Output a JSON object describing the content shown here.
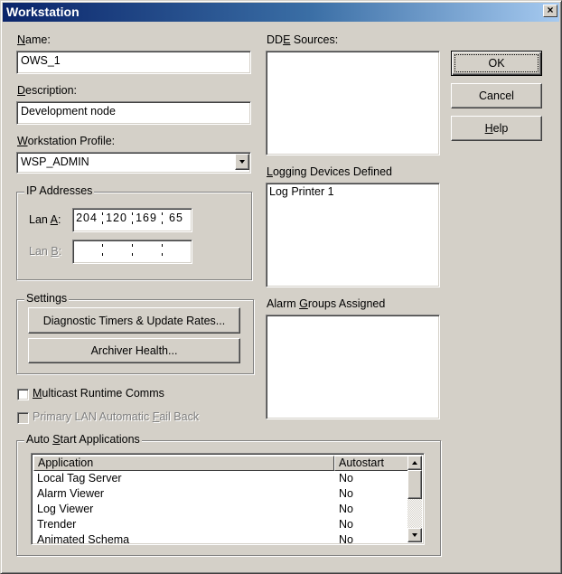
{
  "window": {
    "title": "Workstation",
    "close_glyph": "×"
  },
  "name": {
    "label_pre": "",
    "label_key": "N",
    "label_post": "ame:",
    "value": "OWS_1"
  },
  "description": {
    "label_pre": "",
    "label_key": "D",
    "label_post": "escription:",
    "value": "Development node"
  },
  "profile": {
    "label_pre": "",
    "label_key": "W",
    "label_post": "orkstation Profile:",
    "value": "WSP_ADMIN"
  },
  "ip": {
    "group_label": "IP Addresses",
    "lan_a_pre": "Lan ",
    "lan_a_key": "A",
    "lan_a_post": ":",
    "lan_b_pre": "Lan ",
    "lan_b_key": "B",
    "lan_b_post": ":",
    "lan_a": [
      "204",
      "120",
      "169",
      "65"
    ],
    "lan_b": [
      "",
      "",
      "",
      ""
    ]
  },
  "settings": {
    "group_label": "Settings",
    "diag_button": "Diagnostic Timers & Update Rates...",
    "archiver_button": "Archiver Health..."
  },
  "multicast": {
    "pre": "",
    "key": "M",
    "post": "ulticast Runtime Comms",
    "checked": false
  },
  "primary_lan": {
    "pre": "Primary LAN Automatic ",
    "key": "F",
    "post": "ail Back",
    "checked": false,
    "disabled": true
  },
  "dde": {
    "pre": "DD",
    "key": "E",
    "post": " Sources:",
    "items": []
  },
  "logging": {
    "pre": "",
    "key": "L",
    "post": "ogging Devices Defined",
    "items": [
      "Log Printer 1"
    ]
  },
  "alarm": {
    "pre": "Alarm ",
    "key": "G",
    "post": "roups Assigned",
    "items": []
  },
  "buttons": {
    "ok": "OK",
    "cancel": "Cancel",
    "help_key": "H",
    "help_post": "elp"
  },
  "autostart": {
    "group_pre": "Auto ",
    "group_key": "S",
    "group_post": "tart Applications",
    "columns": [
      "Application",
      "Autostart"
    ],
    "rows": [
      [
        "Local Tag Server",
        "No"
      ],
      [
        "Alarm Viewer",
        "No"
      ],
      [
        "Log Viewer",
        "No"
      ],
      [
        "Trender",
        "No"
      ],
      [
        "Animated Schema",
        "No"
      ]
    ]
  },
  "colors": {
    "title_bar_start": "#0a246a",
    "title_bar_end": "#a6caf0",
    "dialog_face": "#d4d0c8"
  }
}
